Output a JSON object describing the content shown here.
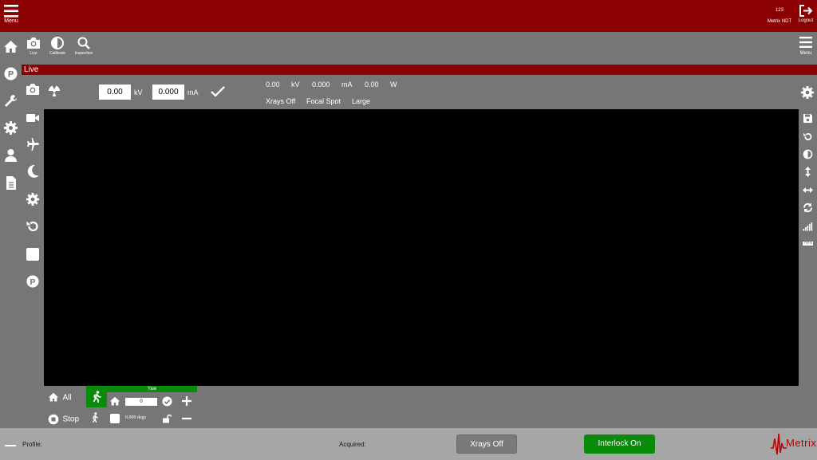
{
  "topbar": {
    "menu_label": "Menu",
    "user_id": "123",
    "company": "Metrix NDT",
    "logout_label": "Logout"
  },
  "toolbar": {
    "live_label": "Live",
    "calibrate_label": "Calibrate",
    "inspection_label": "Inspection",
    "menu_label": "Menu"
  },
  "live": {
    "section_title": "Live",
    "kv_value": "0.00",
    "kv_unit": "kV",
    "ma_value": "0.000",
    "ma_unit": "mA",
    "readout": {
      "kv_value": "0.00",
      "kv_unit": "kV",
      "ma_value": "0.000",
      "ma_unit": "mA",
      "w_value": "0.00",
      "w_unit": "W",
      "xray_state": "Xrays Off",
      "focal_spot_label": "Focal Spot",
      "focal_spot_value": "Large"
    }
  },
  "motion": {
    "all_label": "All",
    "stop_label": "Stop",
    "axis_name": "Yaw",
    "position_value": "0",
    "degrees_value": "0.000 degs"
  },
  "status": {
    "profile_label": "Profile:",
    "acquired_label": "Acquired:",
    "xrays_button": "Xrays Off",
    "interlock_button": "Interlock On",
    "logo_text": "Metrix"
  },
  "colors": {
    "brand_red": "#8b0000",
    "panel_gray": "#767676",
    "status_gray": "#a6a6a6",
    "interlock_green": "#0a8a0a",
    "axis_green": "#0a8a0a"
  }
}
